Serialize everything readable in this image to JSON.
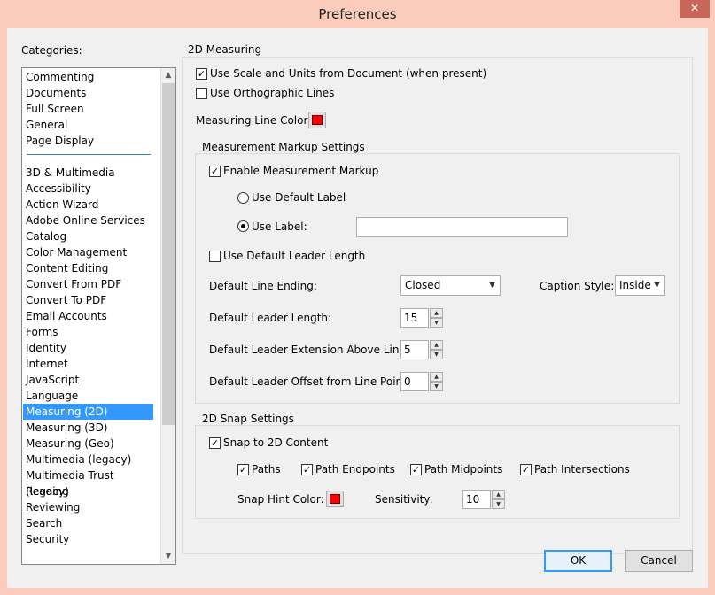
{
  "window": {
    "title": "Preferences",
    "close_glyph": "✕"
  },
  "categories": {
    "label": "Categories:",
    "group1": [
      "Commenting",
      "Documents",
      "Full Screen",
      "General",
      "Page Display"
    ],
    "group2": [
      "3D & Multimedia",
      "Accessibility",
      "Action Wizard",
      "Adobe Online Services",
      "Catalog",
      "Color Management",
      "Content Editing",
      "Convert From PDF",
      "Convert To PDF",
      "Email Accounts",
      "Forms",
      "Identity",
      "Internet",
      "JavaScript",
      "Language",
      "Measuring (2D)",
      "Measuring (3D)",
      "Measuring (Geo)",
      "Multimedia (legacy)",
      "Multimedia Trust (legacy)",
      "Reading",
      "Reviewing",
      "Search",
      "Security"
    ],
    "selected": "Measuring (2D)",
    "scroll_up": "▲",
    "scroll_down": "▼"
  },
  "measuring": {
    "group_label": "2D Measuring",
    "use_scale_label": "Use Scale and Units from Document (when present)",
    "use_scale_checked": true,
    "ortho_label": "Use Orthographic Lines",
    "ortho_checked": false,
    "line_color_label": "Measuring Line Color:",
    "line_color": "#ff0000"
  },
  "markup": {
    "group_label": "Measurement Markup Settings",
    "enable_label": "Enable Measurement Markup",
    "enable_checked": true,
    "default_label_radio": "Use Default Label",
    "use_label_radio": "Use Label:",
    "use_label_selected": true,
    "use_label_value": "",
    "leader_length_cb": "Use Default Leader Length",
    "leader_length_checked": false,
    "line_ending_label": "Default Line Ending:",
    "line_ending_value": "Closed",
    "caption_style_label": "Caption Style:",
    "caption_style_value": "Inside",
    "leader_length_label": "Default Leader Length:",
    "leader_length_value": "15",
    "leader_ext_label": "Default Leader Extension Above Line:",
    "leader_ext_value": "5",
    "leader_offset_label": "Default Leader Offset from Line Points:",
    "leader_offset_value": "0"
  },
  "snap": {
    "group_label": "2D Snap Settings",
    "snap_label": "Snap to 2D Content",
    "snap_checked": true,
    "paths": "Paths",
    "endpoints": "Path Endpoints",
    "midpoints": "Path Midpoints",
    "intersections": "Path Intersections",
    "hint_color_label": "Snap Hint Color:",
    "hint_color": "#ff0000",
    "sensitivity_label": "Sensitivity:",
    "sensitivity_value": "10"
  },
  "buttons": {
    "ok": "OK",
    "cancel": "Cancel"
  },
  "glyphs": {
    "check": "✓",
    "caret": "▼",
    "spin_up": "▲",
    "spin_down": "▼"
  }
}
